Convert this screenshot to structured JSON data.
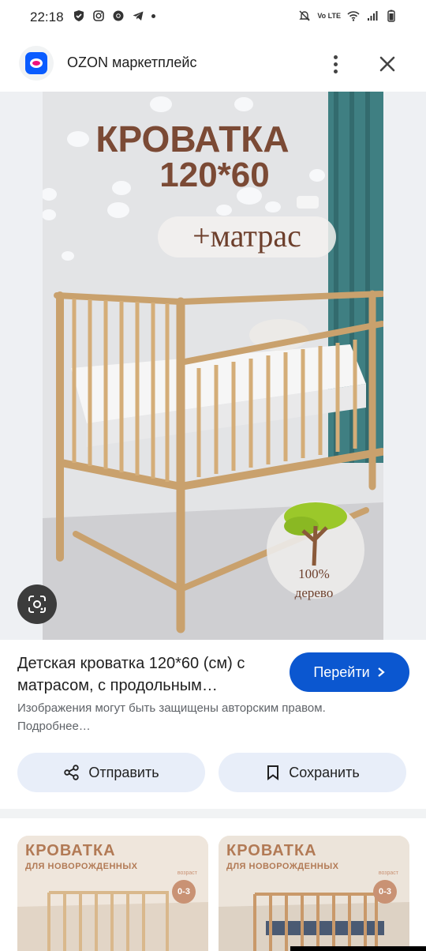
{
  "status_bar": {
    "time": "22:18",
    "left_icons": [
      "shield-icon",
      "instagram-icon",
      "chrome-icon",
      "telegram-icon",
      "dot-icon"
    ],
    "right_icons": [
      "mute-icon",
      "volte-icon",
      "wifi-icon",
      "signal-icon",
      "battery-icon"
    ],
    "volte_label": "Vo LTE"
  },
  "header": {
    "site_name": "OZON маркетплейс",
    "logo_colors": {
      "blue": "#0a5cff",
      "pink": "#f1117e"
    }
  },
  "image": {
    "headline_line1": "КРОВАТКА",
    "headline_line2": "120*60",
    "pill_text": "+матрас",
    "badge_line1": "100%",
    "badge_line2": "дерево"
  },
  "result": {
    "title": "Детская кроватка 120*60 (см) с матрасом, с продольным…",
    "go_label": "Перейти",
    "copyright_note": "Изображения могут быть защищены авторским правом. Подробнее…",
    "share_label": "Отправить",
    "save_label": "Сохранить"
  },
  "related": [
    {
      "title": "КРОВАТКА",
      "subtitle": "ДЛЯ НОВОРОЖДЕННЫХ",
      "badge_top": "возраст",
      "badge": "0-3"
    },
    {
      "title": "КРОВАТКА",
      "subtitle": "ДЛЯ НОВОРОЖДЕННЫХ",
      "badge_top": "возраст",
      "badge": "0-3"
    }
  ],
  "colors": {
    "accent": "#0b57d0",
    "chip": "#e8eef9",
    "headline": "#7b4a35"
  }
}
